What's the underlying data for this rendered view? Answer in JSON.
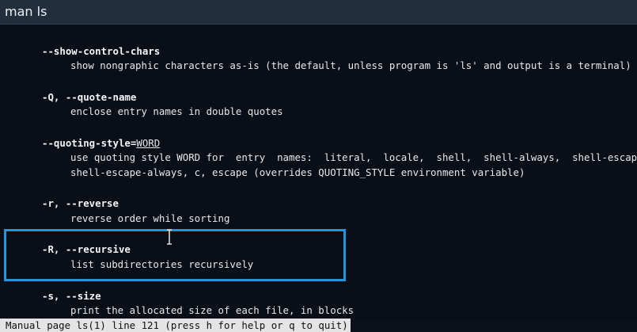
{
  "window": {
    "title": "man ls"
  },
  "man_page": {
    "entries": [
      {
        "option": "--show-control-chars",
        "description": [
          "show nongraphic characters as-is (the default, unless program is 'ls' and output is a terminal)"
        ]
      },
      {
        "option": "-Q, --quote-name",
        "description": [
          "enclose entry names in double quotes"
        ]
      },
      {
        "option_prefix": "--quoting-style=",
        "option_arg": "WORD",
        "description": [
          "use quoting style WORD for  entry  names:  literal,  locale,  shell,  shell-always,  shell-escape,",
          "shell-escape-always, c, escape (overrides QUOTING_STYLE environment variable)"
        ]
      },
      {
        "option": "-r, --reverse",
        "description": [
          "reverse order while sorting"
        ]
      },
      {
        "option": "-R, --recursive",
        "description": [
          "list subdirectories recursively"
        ],
        "highlighted": true
      },
      {
        "option": "-s, --size",
        "description": [
          "print the allocated size of each file, in blocks"
        ]
      }
    ]
  },
  "status_bar": {
    "text": "Manual page ls(1) line 121 (press h for help or q to quit)"
  },
  "cursor": {
    "icon": "text-ibeam-icon"
  },
  "colors": {
    "terminal_background": "#0a0e16",
    "titlebar_background": "#212e3c",
    "highlight_border": "#1e96e0",
    "status_background": "#e4e4e4"
  }
}
